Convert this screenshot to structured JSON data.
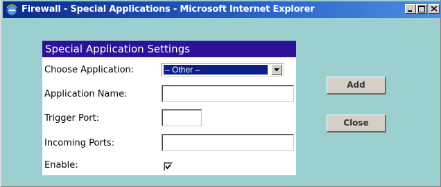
{
  "window": {
    "title": "Firewall - Special Applications - Microsoft Internet Explorer"
  },
  "panel": {
    "header": "Special Application Settings",
    "choose_application": {
      "label": "Choose Application:",
      "selected": "– Other –"
    },
    "application_name": {
      "label": "Application Name:",
      "value": ""
    },
    "trigger_port": {
      "label": "Trigger Port:",
      "value": ""
    },
    "incoming_ports": {
      "label": "Incoming Ports:",
      "value": ""
    },
    "enable": {
      "label": "Enable:",
      "checked": true
    }
  },
  "buttons": {
    "add": "Add",
    "close": "Close"
  },
  "icons": {
    "title": "internet-explorer-icon",
    "minimize": "minimize-icon",
    "maximize": "maximize-icon",
    "close": "close-icon",
    "dropdown": "chevron-down-icon",
    "check": "checkmark-icon"
  },
  "colors": {
    "background": "#9ccfcf",
    "panel_header": "#2d1196",
    "titlebar": "#0a2a8a",
    "selection": "#0b1f86"
  }
}
